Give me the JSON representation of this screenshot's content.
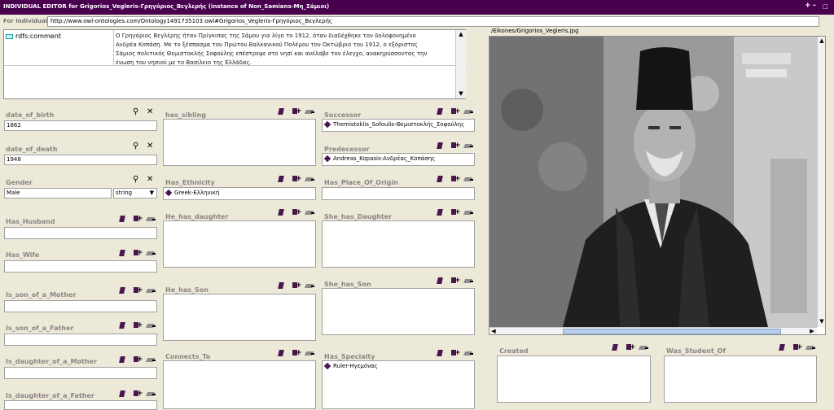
{
  "window": {
    "title": "INDIVIDUAL EDITOR for Grigorios_Vegleris-Γρηγόριος_Βεγλερής  (instance of Non_Samians-Μη_Σάμιοι)",
    "controls": [
      "+",
      "-",
      "□"
    ]
  },
  "individual": {
    "label": "For Individual:",
    "uri": "http://www.owl-ontologies.com/Ontology1491735103.owl#Grigorios_Vegleris-Γρηγόριος_Βεγλερής"
  },
  "comment": {
    "property": "rdfs:comment",
    "text": "Ο Γρηγόριος Βεγλέρης ήταν Πρίγκιπας της Σάμου για λίγο το 1912, όταν διαδέχθηκε τον δολοφονημένο Ανδρέα Κοπάση. Με το ξέσπασμα του Πρώτου Βαλκανικού Πολέμου τον Οκτώβριο του 1912, ο εξόριστος Σάμιος πολιτικός Θεμιστοκλής Σοφούλης επέστρεψε στο νησί και ανέλαβε τον έλεγχο, ανακηρύσσοντας την ένωση του νησιού με το Βασίλειο της Ελλάδας."
  },
  "left_column": {
    "date_of_birth": {
      "label": "date_of_birth",
      "value": "1862"
    },
    "date_of_death": {
      "label": "date_of_death",
      "value": "1948"
    },
    "gender": {
      "label": "Gender",
      "value": "Male",
      "type_value": "string"
    },
    "has_husband": {
      "label": "Has_Husband"
    },
    "has_wife": {
      "label": "Has_Wife"
    },
    "is_son_of_mother": {
      "label": "Is_son_of_a_Mother"
    },
    "is_son_of_father": {
      "label": "Is_son_of_a_Father"
    },
    "is_daughter_of_mother": {
      "label": "Is_daughter_of_a_Mother"
    },
    "is_daughter_of_father": {
      "label": "Is_daughter_of_a_Father"
    }
  },
  "middle_column": {
    "has_sibling": {
      "label": "has_sibling"
    },
    "has_ethnicity": {
      "label": "Has_Ethnicity",
      "entries": [
        "Greek-Ελληνική"
      ]
    },
    "he_has_daughter": {
      "label": "He_has_daughter"
    },
    "he_has_son": {
      "label": "He_has_Son"
    },
    "connects_to": {
      "label": "Connects_To"
    }
  },
  "right_column": {
    "successor": {
      "label": "Successor",
      "entries": [
        "Themistoklis_Sofoulis-Θεμιστοκλής_Σοφούλης"
      ]
    },
    "predecessor": {
      "label": "Predecessor",
      "entries": [
        "Andreas_Kopasis-Ανδρέας_Κοπάσης"
      ]
    },
    "has_place_of_origin": {
      "label": "Has_Place_Of_Origin"
    },
    "she_has_daughter": {
      "label": "She_has_Daughter"
    },
    "she_has_son": {
      "label": "She_has_Son"
    },
    "has_specialty": {
      "label": "Has_Specialty",
      "entries": [
        "Ruler-Ηγεμόνας"
      ]
    }
  },
  "image_panel": {
    "path": "/Eikones/Grigorios_Vegleris.jpg"
  },
  "bottom_right": {
    "created": {
      "label": "Created"
    },
    "was_student_of": {
      "label": "Was_Student_Of"
    }
  },
  "colors": {
    "title_bar": "#48004f",
    "label_gray": "#8c8484",
    "instance_icon": "#4b164f",
    "panel_bg": "#ece9d8"
  },
  "icons": {
    "tools": [
      "create-instance-icon",
      "add-value-icon",
      "remove-value-icon"
    ],
    "datatype_tools": [
      "find-icon",
      "delete-icon"
    ]
  }
}
